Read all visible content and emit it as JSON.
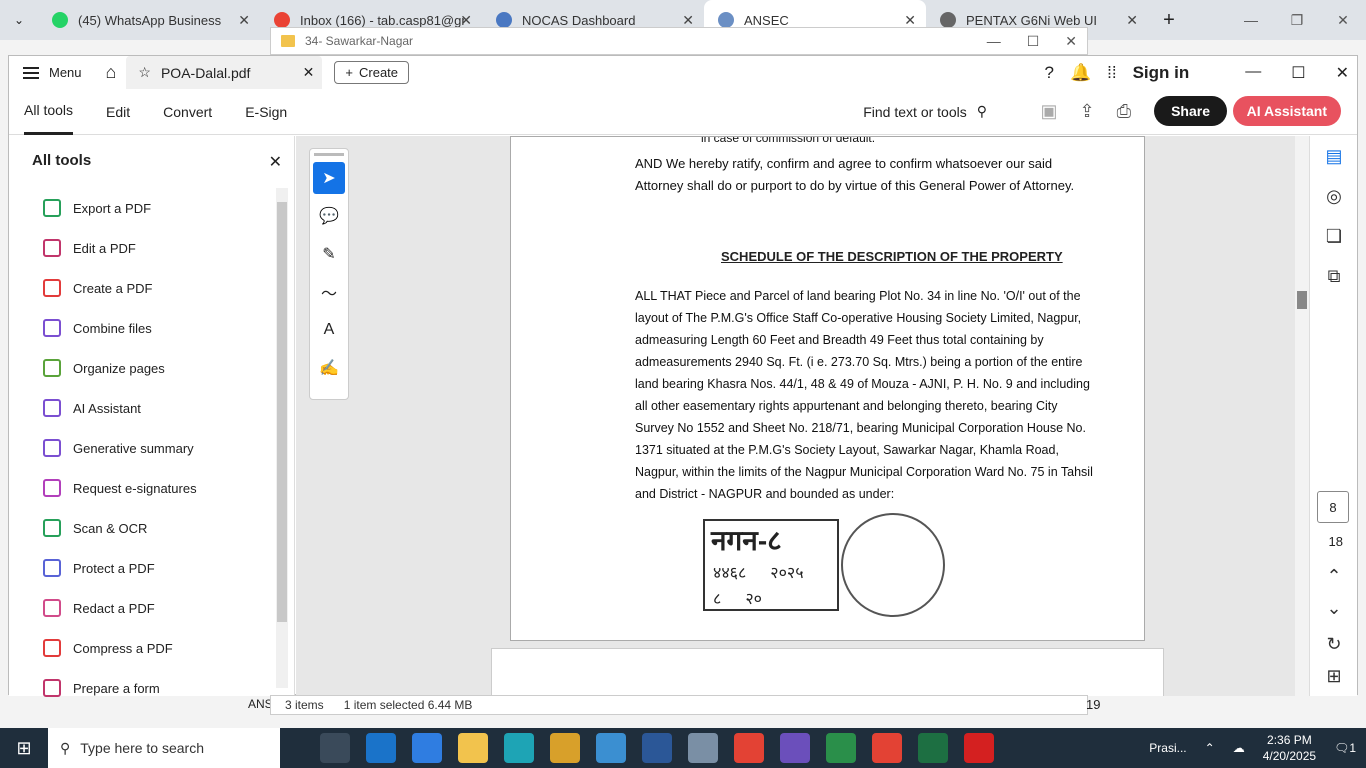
{
  "browser": {
    "tabs": [
      {
        "title": "(45) WhatsApp Business",
        "color": "#25d366"
      },
      {
        "title": "Inbox (166) - tab.casp81@gr",
        "color": "#ea4335"
      },
      {
        "title": "NOCAS Dashboard",
        "color": "#4a78c2"
      },
      {
        "title": "ANSEC",
        "color": "#6b8fc4"
      },
      {
        "title": "PENTAX G6Ni Web UI",
        "color": "#666666"
      }
    ],
    "active_tab_index": 3
  },
  "explorer": {
    "title": "34- Sawarkar-Nagar",
    "status_items": "3 items",
    "status_selected": "1 item selected 6.44 MB",
    "left_peek": "ANS",
    "right_peek": "19"
  },
  "acrobat": {
    "menu_label": "Menu",
    "doc_tab": "POA-Dalal.pdf",
    "create_label": "Create",
    "signin_label": "Sign in",
    "tool_tabs": [
      "All tools",
      "Edit",
      "Convert",
      "E-Sign"
    ],
    "find_placeholder": "Find text or tools",
    "share_label": "Share",
    "ai_assistant_label": "AI Assistant",
    "panel_title": "All tools",
    "tools": [
      {
        "label": "Export a PDF",
        "icon": "export-pdf-icon",
        "color": "#27a05a"
      },
      {
        "label": "Edit a PDF",
        "icon": "edit-pdf-icon",
        "color": "#c1356b"
      },
      {
        "label": "Create a PDF",
        "icon": "create-pdf-icon",
        "color": "#e23b3b"
      },
      {
        "label": "Combine files",
        "icon": "combine-files-icon",
        "color": "#7b4fd1"
      },
      {
        "label": "Organize pages",
        "icon": "organize-pages-icon",
        "color": "#5aa33a"
      },
      {
        "label": "AI Assistant",
        "icon": "ai-assistant-icon",
        "color": "#7b4fd1"
      },
      {
        "label": "Generative summary",
        "icon": "generative-summary-icon",
        "color": "#7b4fd1"
      },
      {
        "label": "Request e-signatures",
        "icon": "request-esignatures-icon",
        "color": "#b23fbb"
      },
      {
        "label": "Scan & OCR",
        "icon": "scan-ocr-icon",
        "color": "#27a05a"
      },
      {
        "label": "Protect a PDF",
        "icon": "protect-pdf-icon",
        "color": "#5963d6"
      },
      {
        "label": "Redact a PDF",
        "icon": "redact-pdf-icon",
        "color": "#d14b8a"
      },
      {
        "label": "Compress a PDF",
        "icon": "compress-pdf-icon",
        "color": "#e23b3b"
      },
      {
        "label": "Prepare a form",
        "icon": "prepare-form-icon",
        "color": "#c1356b"
      }
    ],
    "page_current": "8",
    "page_total": "18"
  },
  "pdf": {
    "line_top": "in case of commission of default.",
    "para1": "AND We hereby ratify, confirm and agree to confirm whatsoever our said Attorney shall do or purport to do by virtue of this General Power of Attorney.",
    "heading": "SCHEDULE OF THE DESCRIPTION OF THE PROPERTY",
    "para2": "ALL THAT Piece and Parcel of land bearing Plot No. 34 in line No. 'O/I' out of the layout of The P.M.G's Office Staff Co-operative Housing Society Limited, Nagpur, admeasuring Length 60 Feet and Breadth 49 Feet thus total containing by admeasurements 2940 Sq. Ft. (i e. 273.70 Sq. Mtrs.) being a portion of the entire land bearing Khasra Nos. 44/1, 48 & 49 of Mouza - AJNI, P. H. No. 9 and including all other easementary rights appurtenant and belonging thereto, bearing City Survey No 1552 and Sheet No. 218/71, bearing Municipal Corporation House No. 1371 situated at the P.M.G's Society Layout, Sawarkar Nagar, Khamla Road, Nagpur, within the limits of the Nagpur Municipal Corporation Ward No. 75 in Tahsil and District - NAGPUR and bounded as under:",
    "stamp_title": "नगन-८",
    "stamp_r1a": "४४६८",
    "stamp_r1b": "२०२५",
    "stamp_r2a": "८",
    "stamp_r2b": "२०"
  },
  "taskbar": {
    "search_placeholder": "Type here to search",
    "user": "Prasi...",
    "time": "2:36 PM",
    "date": "4/20/2025",
    "notif": "1"
  }
}
